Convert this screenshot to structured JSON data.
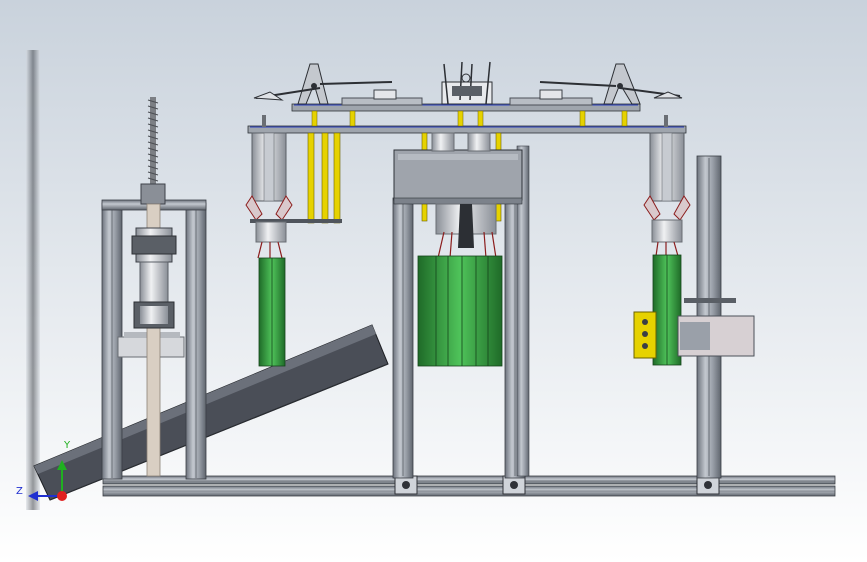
{
  "viewport": {
    "background_top": "#c9d2dc",
    "background_bottom": "#ffffff"
  },
  "colors": {
    "aluminum": "#a9afb8",
    "aluminum_dark": "#6c727c",
    "plate": "#8b9099",
    "green": "#3fae49",
    "green_dark": "#1f6b28",
    "yellow": "#e6d200",
    "chute": "#4a4e57",
    "screw": "#7c7f84",
    "pink": "#c9a0a8",
    "red_wire": "#8b1d1d"
  },
  "triad": {
    "y_label": "Y",
    "z_label": "Z",
    "x_color": "#e02020",
    "y_color": "#20b020",
    "z_color": "#2030d0"
  }
}
